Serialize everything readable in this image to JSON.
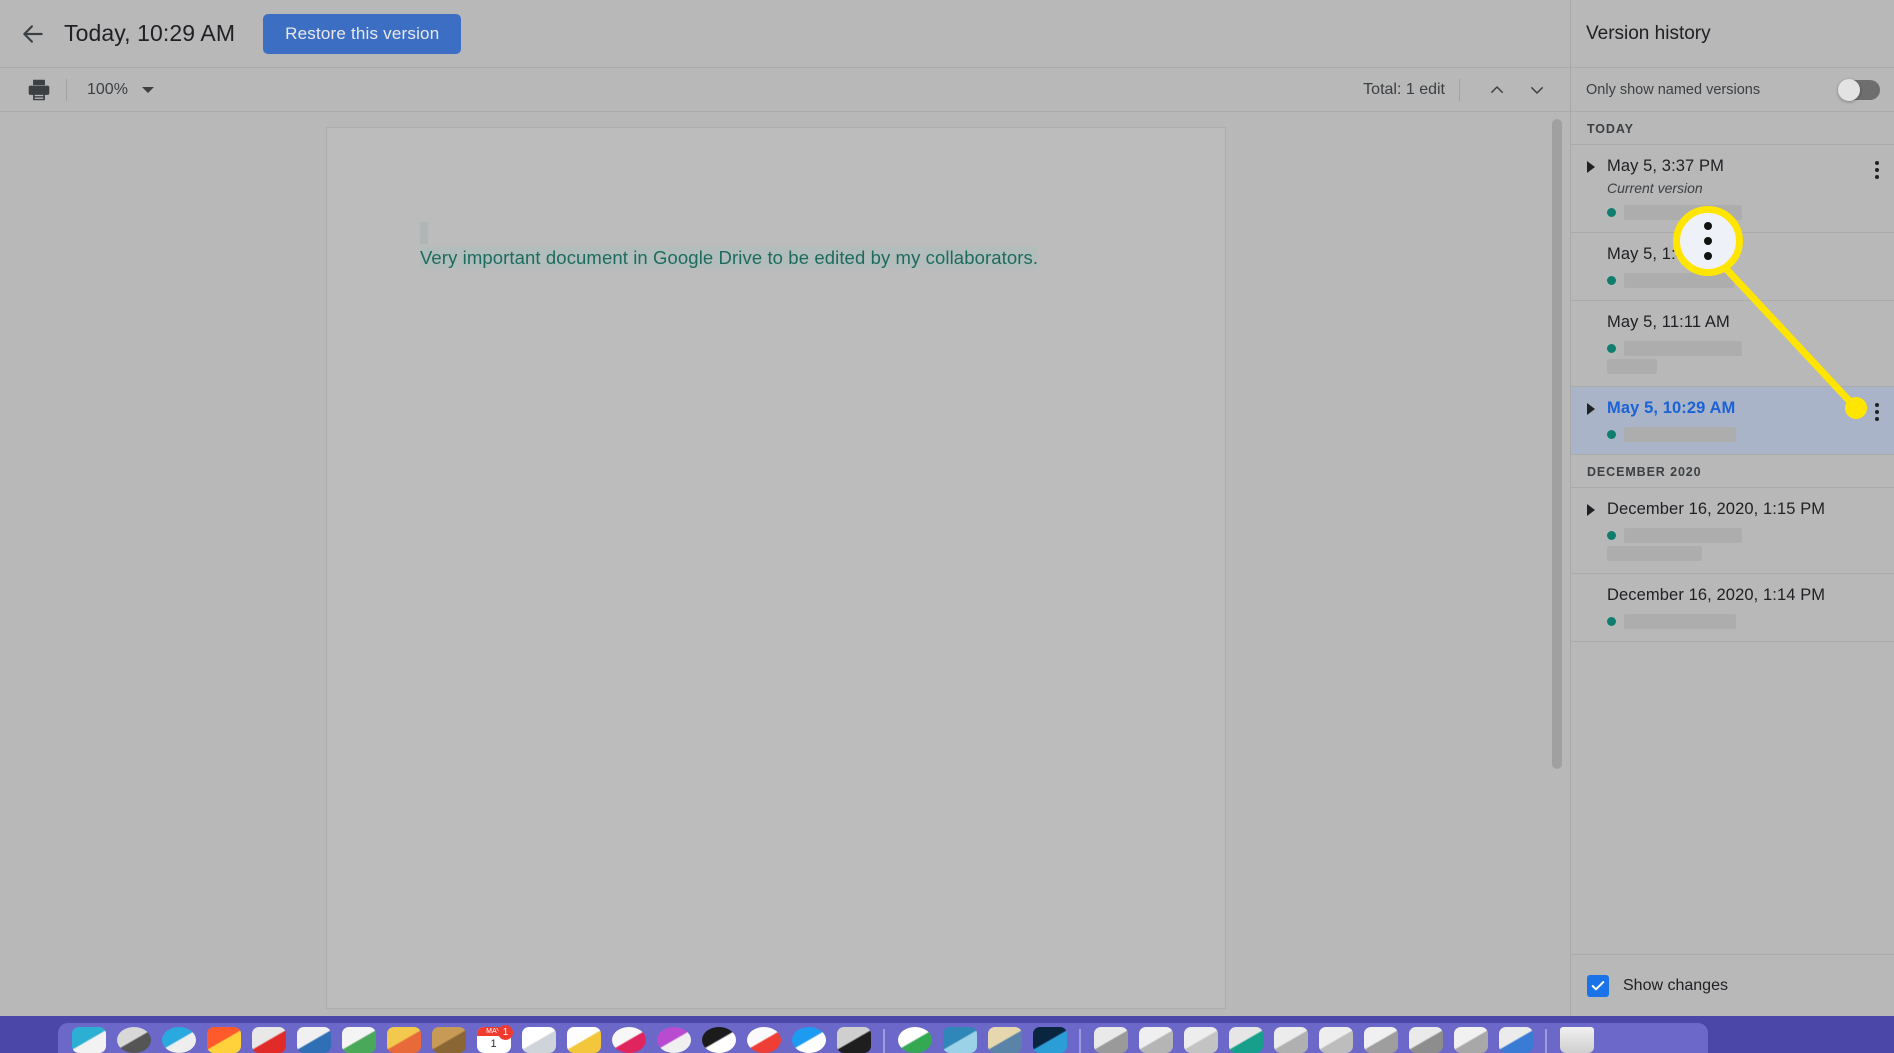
{
  "topbar": {
    "back_icon": "arrow-left-icon",
    "title": "Today, 10:29 AM",
    "restore_label": "Restore this version"
  },
  "toolbar": {
    "print_icon": "printer-icon",
    "zoom_value": "100%",
    "zoom_caret_icon": "caret-down-icon",
    "edits_total": "Total: 1 edit",
    "prev_icon": "chevron-up-icon",
    "next_icon": "chevron-down-icon"
  },
  "document": {
    "cursor": "text-cursor-block",
    "paragraph": "Very important document in Google Drive to be edited by my collaborators.",
    "text_color": "#1d6b5f",
    "highlight_color": "#b3bdbb"
  },
  "sidebar": {
    "title": "Version history",
    "named_toggle_label": "Only show named versions",
    "named_toggle_state": "off",
    "groups": [
      {
        "header": "TODAY",
        "versions": [
          {
            "label": "May 5, 3:37 PM",
            "has_arrow": true,
            "current_label": "Current version",
            "selected": false,
            "redact_width": 118,
            "redact2_width": 0,
            "has_more": true
          },
          {
            "label": "May 5, 1:45 PM",
            "has_arrow": false,
            "current_label": "",
            "selected": false,
            "redact_width": 110,
            "redact2_width": 0,
            "has_more": false
          },
          {
            "label": "May 5, 11:11 AM",
            "has_arrow": false,
            "current_label": "",
            "selected": false,
            "redact_width": 118,
            "redact2_width": 50,
            "has_more": false
          },
          {
            "label": "May 5, 10:29 AM",
            "has_arrow": true,
            "current_label": "",
            "selected": true,
            "redact_width": 112,
            "redact2_width": 0,
            "has_more": true
          }
        ]
      },
      {
        "header": "DECEMBER 2020",
        "versions": [
          {
            "label": "December 16, 2020, 1:15 PM",
            "has_arrow": true,
            "current_label": "",
            "selected": false,
            "redact_width": 118,
            "redact2_width": 95,
            "has_more": false
          },
          {
            "label": "December 16, 2020, 1:14 PM",
            "has_arrow": false,
            "current_label": "",
            "selected": false,
            "redact_width": 112,
            "redact2_width": 0,
            "has_more": false
          }
        ]
      }
    ],
    "show_changes_label": "Show changes",
    "show_changes_checked": true,
    "show_changes_color": "#1a73e8"
  },
  "callout": {
    "kind": "magnifier-callout",
    "bubble_icon": "overflow-menu-dots-icon",
    "line_color": "#ffe500",
    "target": "more-actions-for-may-5-10-29-am"
  },
  "dock": {
    "badge_count": "1",
    "calendar_month": "MAY",
    "calendar_day": "1",
    "icons": [
      {
        "name": "finder-icon",
        "colors": [
          "#2bb0d4",
          "#f2f2f2"
        ]
      },
      {
        "name": "launchpad-icon",
        "colors": [
          "#d8d8d8",
          "#555555"
        ],
        "round": true
      },
      {
        "name": "safari-icon",
        "colors": [
          "#2aa8e0",
          "#eeeeee"
        ],
        "round": true
      },
      {
        "name": "photos-icon",
        "colors": [
          "#ff5a2b",
          "#ffd23c"
        ]
      },
      {
        "name": "camera-icon",
        "colors": [
          "#e8e8e8",
          "#e02b28"
        ]
      },
      {
        "name": "stamp-photo-icon",
        "colors": [
          "#f0f0f0",
          "#2e6fb5"
        ]
      },
      {
        "name": "keynote-icon",
        "colors": [
          "#f4f4f4",
          "#4aa85a"
        ]
      },
      {
        "name": "maps-icon",
        "colors": [
          "#f2c94c",
          "#e86a3a"
        ]
      },
      {
        "name": "contacts-icon",
        "colors": [
          "#c79a56",
          "#8a6634"
        ]
      },
      {
        "name": "calendar-icon",
        "colors": [
          "#ffffff",
          "#f03b2e"
        ]
      },
      {
        "name": "notes-card-icon",
        "colors": [
          "#ffffff",
          "#cfd4da"
        ]
      },
      {
        "name": "reminders-icon",
        "colors": [
          "#fdfdfd",
          "#f3c63c"
        ]
      },
      {
        "name": "music-icon",
        "colors": [
          "#f7f7f7",
          "#e0245e"
        ],
        "round": true
      },
      {
        "name": "podcasts-icon",
        "colors": [
          "#b84bd0",
          "#f0f0f0"
        ],
        "round": true
      },
      {
        "name": "tv-icon",
        "colors": [
          "#1b1b1b",
          "#ffffff"
        ],
        "round": true
      },
      {
        "name": "news-icon",
        "colors": [
          "#fafafa",
          "#ef3e36"
        ],
        "round": true
      },
      {
        "name": "appstore-icon",
        "colors": [
          "#1d9bf0",
          "#ffffff"
        ],
        "round": true
      },
      {
        "name": "system-prefs-icon",
        "colors": [
          "#cfcfcf",
          "#1e1e1e"
        ]
      },
      {
        "name": "separator",
        "colors": []
      },
      {
        "name": "chrome-icon",
        "colors": [
          "#ffffff",
          "#35a853"
        ],
        "round": true
      },
      {
        "name": "vmware-icon",
        "colors": [
          "#2f86b8",
          "#9cd2e8"
        ]
      },
      {
        "name": "picture-frame-icon",
        "colors": [
          "#e7d7ae",
          "#5b83a8"
        ]
      },
      {
        "name": "paypal-icon",
        "colors": [
          "#0a2540",
          "#2b9ed8"
        ]
      },
      {
        "name": "separator",
        "colors": []
      },
      {
        "name": "window-doc-icon",
        "colors": [
          "#e9e9e9",
          "#9a9a9a"
        ]
      },
      {
        "name": "window-text-icon",
        "colors": [
          "#efefef",
          "#b5b5b5"
        ]
      },
      {
        "name": "window-blank-icon",
        "colors": [
          "#ededed",
          "#c3c3c3"
        ]
      },
      {
        "name": "window-green-icon",
        "colors": [
          "#e6e6e6",
          "#16a08c"
        ]
      },
      {
        "name": "window-form-icon",
        "colors": [
          "#ececec",
          "#b0b0b0"
        ]
      },
      {
        "name": "window-list-icon",
        "colors": [
          "#eeeeee",
          "#bdbdbd"
        ]
      },
      {
        "name": "window-sheet-icon",
        "colors": [
          "#f0f0f0",
          "#9e9e9e"
        ]
      },
      {
        "name": "window-news-icon",
        "colors": [
          "#eaeaea",
          "#8d8d8d"
        ]
      },
      {
        "name": "window-pane-icon",
        "colors": [
          "#f1f1f1",
          "#a8a8a8"
        ]
      },
      {
        "name": "window-blue-icon",
        "colors": [
          "#ebebeb",
          "#3a7bd5"
        ]
      },
      {
        "name": "separator",
        "colors": []
      },
      {
        "name": "trash-icon",
        "colors": [
          "#dcdcdc",
          "#8b8b8b"
        ]
      }
    ]
  }
}
